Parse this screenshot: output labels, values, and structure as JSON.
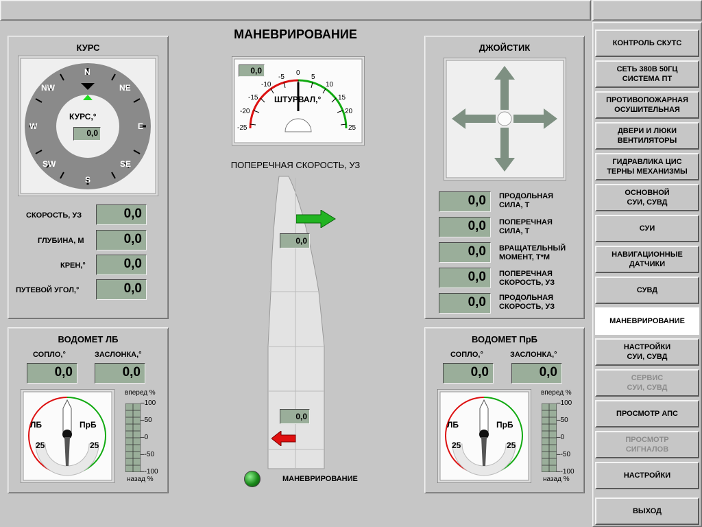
{
  "page_title": "МАНЕВРИРОВАНИЕ",
  "course": {
    "title": "КУРС",
    "compass_label": "КУРС,°",
    "value": "0,0",
    "directions": {
      "n": "N",
      "ne": "NE",
      "e": "E",
      "se": "SE",
      "s": "S",
      "sw": "SW",
      "w": "W",
      "nw": "NW"
    }
  },
  "readouts_left": [
    {
      "label": "СКОРОСТЬ, УЗ",
      "value": "0,0"
    },
    {
      "label": "ГЛУБИНА, М",
      "value": "0,0"
    },
    {
      "label": "КРЕН,°",
      "value": "0,0"
    },
    {
      "label": "ПУТЕВОЙ УГОЛ,°",
      "value": "0,0"
    }
  ],
  "wheel": {
    "label": "ШТУРВАЛ,°",
    "value": "0,0",
    "ticks": [
      "-25",
      "-20",
      "-15",
      "-10",
      "-5",
      "0",
      "5",
      "10",
      "15",
      "20",
      "25"
    ]
  },
  "lateral_speed_title": "ПОПЕРЕЧНАЯ СКОРОСТЬ, УЗ",
  "hull": {
    "bow_value": "0,0",
    "stern_value": "0,0"
  },
  "maneuver_indicator": {
    "label": "МАНЕВРИРОВАНИЕ",
    "color": "#1a8a1a"
  },
  "joystick": {
    "title": "ДЖОЙСТИК",
    "readouts": [
      {
        "label": "ПРОДОЛЬНАЯ\nСИЛА, Т",
        "value": "0,0"
      },
      {
        "label": "ПОПЕРЕЧНАЯ\nСИЛА, Т",
        "value": "0,0"
      },
      {
        "label": "ВРАЩАТЕЛЬНЫЙ\nМОМЕНТ, Т*М",
        "value": "0,0"
      },
      {
        "label": "ПОПЕРЕЧНАЯ\nСКОРОСТЬ, УЗ",
        "value": "0,0"
      },
      {
        "label": "ПРОДОЛЬНАЯ\nСКОРОСТЬ, УЗ",
        "value": "0,0"
      }
    ]
  },
  "waterjet_left": {
    "title": "ВОДОМЕТ ЛБ",
    "nozzle_label": "СОПЛО,°",
    "nozzle_value": "0,0",
    "flap_label": "ЗАСЛОНКА,°",
    "flap_value": "0,0",
    "gauge_left": "ЛБ",
    "gauge_right": "ПрБ",
    "scale_left": "25",
    "scale_right": "25",
    "bar_top": "вперед %",
    "bar_bottom": "назад %",
    "bar_ticks": [
      "100",
      "50",
      "0",
      "-50",
      "-100"
    ]
  },
  "waterjet_right": {
    "title": "ВОДОМЕТ ПрБ",
    "nozzle_label": "СОПЛО,°",
    "nozzle_value": "0,0",
    "flap_label": "ЗАСЛОНКА,°",
    "flap_value": "0,0",
    "gauge_left": "ЛБ",
    "gauge_right": "ПрБ",
    "scale_left": "25",
    "scale_right": "25",
    "bar_top": "вперед %",
    "bar_bottom": "назад %",
    "bar_ticks": [
      "100",
      "50",
      "0",
      "-50",
      "-100"
    ]
  },
  "nav": [
    {
      "label": "КОНТРОЛЬ СКУТС",
      "state": "normal"
    },
    {
      "label": "СЕТЬ 380В 50ГЦ\nСИСТЕМА ПТ",
      "state": "normal"
    },
    {
      "label": "ПРОТИВОПОЖАРНАЯ\nОСУШИТЕЛЬНАЯ",
      "state": "normal"
    },
    {
      "label": "ДВЕРИ И ЛЮКИ\nВЕНТИЛЯТОРЫ",
      "state": "normal"
    },
    {
      "label": "ГИДРАВЛИКА ЦИС\nТЕРНЫ МЕХАНИЗМЫ",
      "state": "normal"
    },
    {
      "label": "ОСНОВНОЙ\nСУИ, СУВД",
      "state": "normal"
    },
    {
      "label": "СУИ",
      "state": "normal"
    },
    {
      "label": "НАВИГАЦИОННЫЕ\nДАТЧИКИ",
      "state": "normal"
    },
    {
      "label": "СУВД",
      "state": "normal"
    },
    {
      "label": "МАНЕВРИРОВАНИЕ",
      "state": "active"
    },
    {
      "label": "НАСТРОЙКИ\nСУИ, СУВД",
      "state": "normal"
    },
    {
      "label": "СЕРВИС\nСУИ, СУВД",
      "state": "disabled"
    },
    {
      "label": "ПРОСМОТР АПС",
      "state": "normal"
    },
    {
      "label": "ПРОСМОТР\nСИГНАЛОВ",
      "state": "disabled"
    },
    {
      "label": "НАСТРОЙКИ",
      "state": "normal"
    },
    {
      "label": "ВЫХОД",
      "state": "normal"
    }
  ],
  "colors": {
    "display_bg": "#9aae9a",
    "green_arrow": "#22b422",
    "red_arrow": "#e01010",
    "arc_red": "#dd1111",
    "arc_green": "#11aa11"
  }
}
